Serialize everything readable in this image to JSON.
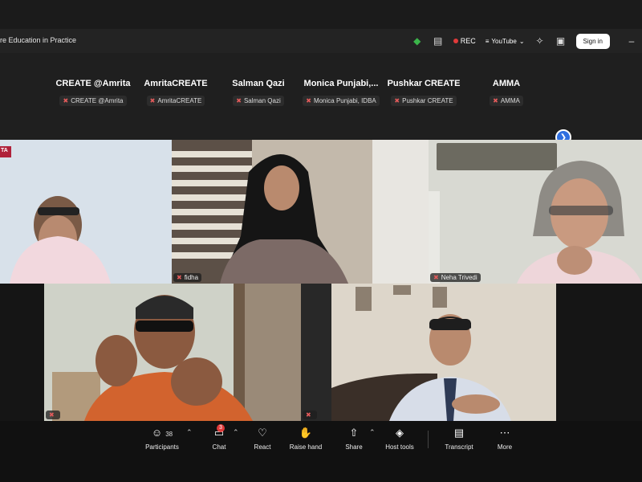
{
  "window": {
    "title": "re Education in Practice",
    "rec_label": "REC",
    "youtube_label": "YouTube",
    "signin_label": "Sign in"
  },
  "participants_strip": [
    {
      "name": "CREATE @Amrita",
      "tag": "CREATE @Amrita"
    },
    {
      "name": "AmritaCREATE",
      "tag": "AmritaCREATE"
    },
    {
      "name": "Salman Qazi",
      "tag": "Salman Qazi"
    },
    {
      "name": "Monica  Punjabi,...",
      "tag": "Monica Punjabi, IDBA"
    },
    {
      "name": "Pushkar CREATE",
      "tag": "Pushkar CREATE"
    },
    {
      "name": "AMMA",
      "tag": "AMMA"
    }
  ],
  "tiles": [
    {
      "label": "",
      "logo_text": "TA"
    },
    {
      "label": "fidha"
    },
    {
      "label": "Neha Trivedi"
    },
    {
      "label": ""
    },
    {
      "label": ""
    }
  ],
  "controls": {
    "participants": {
      "label": "Participants",
      "count": "38"
    },
    "chat": {
      "label": "Chat",
      "badge": "3"
    },
    "react": {
      "label": "React"
    },
    "raise_hand": {
      "label": "Raise hand"
    },
    "share": {
      "label": "Share"
    },
    "host_tools": {
      "label": "Host tools"
    },
    "transcript": {
      "label": "Transcript"
    },
    "more": {
      "label": "More"
    }
  },
  "colors": {
    "accent_blue": "#2f6fe0",
    "rec_red": "#e03a3a",
    "shield_green": "#3bb54a"
  }
}
